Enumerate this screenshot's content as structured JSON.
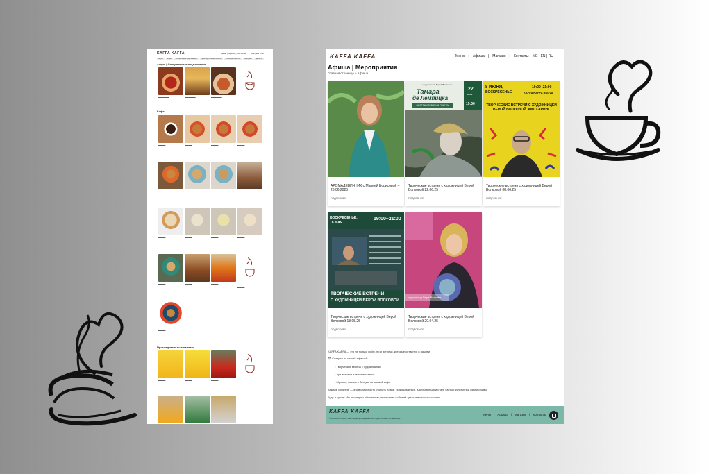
{
  "menu_page": {
    "logo": "KAFFA KAFFA",
    "nav": "Меню | Афиша | Контакты",
    "lang": "ME | EN | RU",
    "tabs": [
      "Акции",
      "Кофе",
      "Специальные предложения",
      "Прохладительные напитки",
      "Холодные напитки",
      "Завтраки",
      "Десерты",
      "Выпечка",
      "Вино",
      "Пиво",
      "Бар"
    ],
    "sections": {
      "specials": "Акции | Специальные предложения",
      "coffee": "Кофе",
      "drinks": "Прохладительные напитки"
    }
  },
  "events_page": {
    "logo": "KAFFA KAFFA",
    "nav": [
      "Меню",
      "Афиша",
      "Магазин",
      "Контакты"
    ],
    "lang": "ME | EN | RU",
    "title": "Афиша | Мероприятия",
    "breadcrumb": "Главная страница » Афиша",
    "events": [
      {
        "title": "АРОМАДЕВИЧНИК с Марией Борисовой – 20.06.2025",
        "more": "ПОДРОБНЕЕ"
      },
      {
        "title": "Творческие встречи с художницей Верой Волковой 22.06.25",
        "more": "ПОДРОБНЕЕ"
      },
      {
        "title": "Творческие встречи с художницей Верой Волковой 08.06.25",
        "more": "ПОДРОБНЕЕ"
      },
      {
        "title": "Творческие встречи с художницей Верой Волковой 18.05.25",
        "more": "ПОДРОБНЕЕ"
      },
      {
        "title": "Творческие встречи с художницей Верой Волковой 20.04.25",
        "more": "ПОДРОБНЕЕ"
      }
    ],
    "posters": {
      "p2_top": "с художницей Верой Волковой",
      "p2_name1": "Тамара",
      "p2_name2": "де Лемпицка",
      "p2_sub": "СМОТРИМ ГОВОРИМ РИСУЕМ",
      "p2_date": "22",
      "p2_month": "июня",
      "p2_time": "19:00",
      "p3_date": "8 ИЮНЯ,",
      "p3_day": "ВОСКРЕСЕНЬЕ",
      "p3_time": "19:00–21:00",
      "p3_place": "KAFFA KAFFA BUDVA",
      "p3_body": "ТВОРЧЕСКИЕ ВСТРЕЧИ С ХУДОЖНИЦЕЙ ВЕРОЙ ВОЛКОВОЙ. КИТ ХАРИНГ",
      "p4_day": "ВОСКРЕСЕНЬЕ,",
      "p4_date": "18 МАЯ",
      "p4_time": "19:00–21:00",
      "p4_body1": "ТВОРЧЕСКИЕ ВСТРЕЧИ",
      "p4_body2": "С ХУДОЖНИЦЕЙ ВЕРОЙ ВОЛКОВОЙ",
      "p5_caption": "художница Вера Волкова"
    },
    "intro": "KAFFA KAFFA — это не только кофе, но и встречи, которые остаются в памяти.",
    "follow": "📅 Следите за нашей афишей:",
    "list": [
      "Творческие вечера с художниками",
      "Арт-встречи и мини-выставки",
      "Музыка, поэзия и беседы за чашкой кофе"
    ],
    "para1": "Каждое событие — это возможность открыть новое, познакомиться, вдохновиться и стать частью культурной жизни Будвы.",
    "para2": "Будь в курсе! Мы регулярно обновляем расписание событий здесь и в наших соцсетях.",
    "footer": {
      "logo": "KAFFA KAFFA",
      "copy": "© 2025 KAFFA KAFFA | Сайт создан при поддержке веб-студии. Оптовые поставки кофе",
      "nav": [
        "Меню",
        "Афиша",
        "Магазин",
        "Контакты"
      ]
    }
  },
  "colors": {
    "footer": "#7bb8a8",
    "poster_yellow": "#e8d41e",
    "poster_green": "#1e4a3a",
    "poster_pink": "#c8467e"
  }
}
